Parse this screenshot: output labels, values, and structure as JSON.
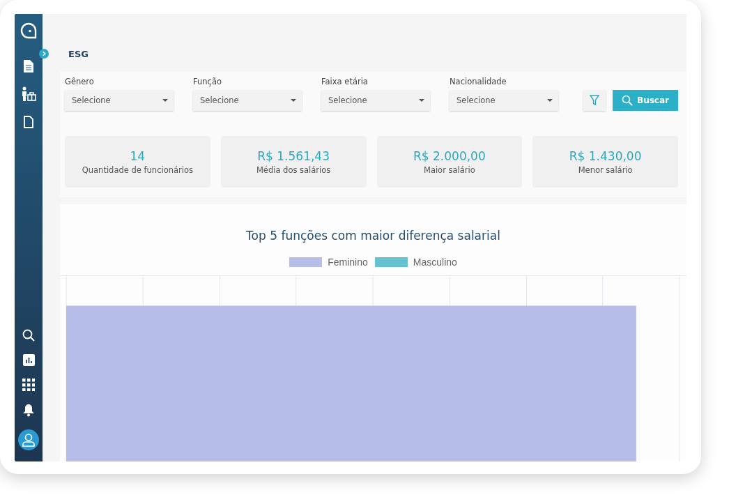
{
  "page": {
    "title": "ESG"
  },
  "filters": [
    {
      "label": "Gênero",
      "placeholder": "Selecione"
    },
    {
      "label": "Função",
      "placeholder": "Selecione"
    },
    {
      "label": "Faixa etária",
      "placeholder": "Selecione"
    },
    {
      "label": "Nacionalidade",
      "placeholder": "Selecione"
    }
  ],
  "search_button": "Buscar",
  "stats": [
    {
      "value": "14",
      "label": "Quantidade de funcionários"
    },
    {
      "value": "R$ 1.561,43",
      "label": "Média dos salários"
    },
    {
      "value": "R$ 2.000,00",
      "label": "Maior salário"
    },
    {
      "value": "R$ 1.430,00",
      "label": "Menor salário"
    }
  ],
  "chart": {
    "title": "Top 5 funções com maior diferença salarial",
    "legend": [
      {
        "label": "Feminino",
        "color": "#b7bde9"
      },
      {
        "label": "Masculino",
        "color": "#66c2d0"
      }
    ]
  }
}
